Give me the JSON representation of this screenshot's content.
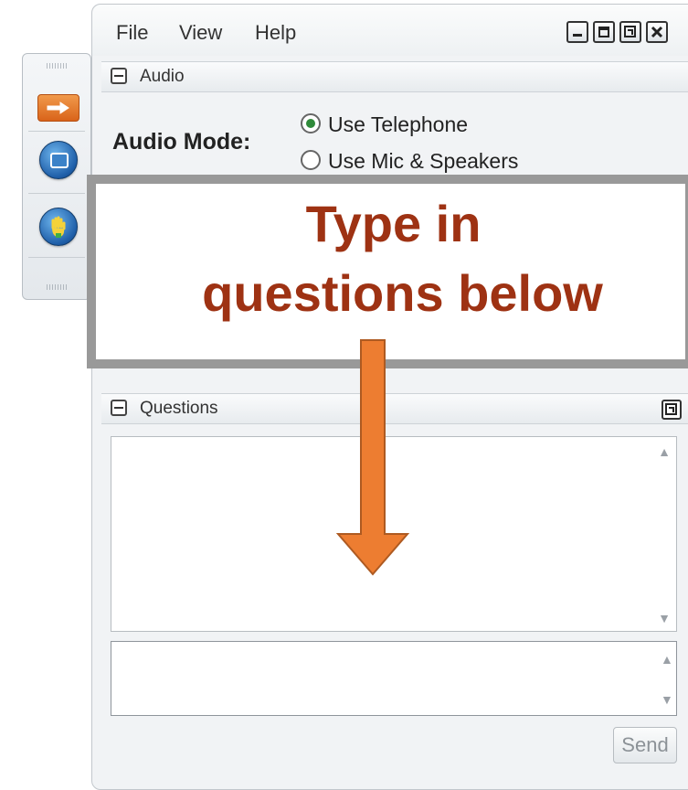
{
  "menu": {
    "file": "File",
    "view": "View",
    "help": "Help"
  },
  "audio": {
    "section_title": "Audio",
    "mode_label": "Audio Mode:",
    "options": [
      "Use Telephone",
      "Use Mic & Speakers"
    ],
    "selected": "Use Telephone"
  },
  "questions": {
    "section_title": "Questions",
    "input_value": "",
    "send_label": "Send"
  },
  "callout": {
    "line1": "Type in",
    "line2": "questions below"
  },
  "colors": {
    "callout_text": "#9e3213",
    "callout_border": "#999999",
    "arrow_fill": "#ed7d31",
    "arrow_stroke": "#ae5a21",
    "toolbar_button_orange": "#e3762a",
    "toolbar_button_blue": "#1e5ea8"
  },
  "icons": [
    "arrow-right-icon",
    "window-icon",
    "raise-hand-icon",
    "minimize-icon",
    "maximize-icon",
    "restore-icon",
    "close-icon",
    "popout-icon"
  ]
}
